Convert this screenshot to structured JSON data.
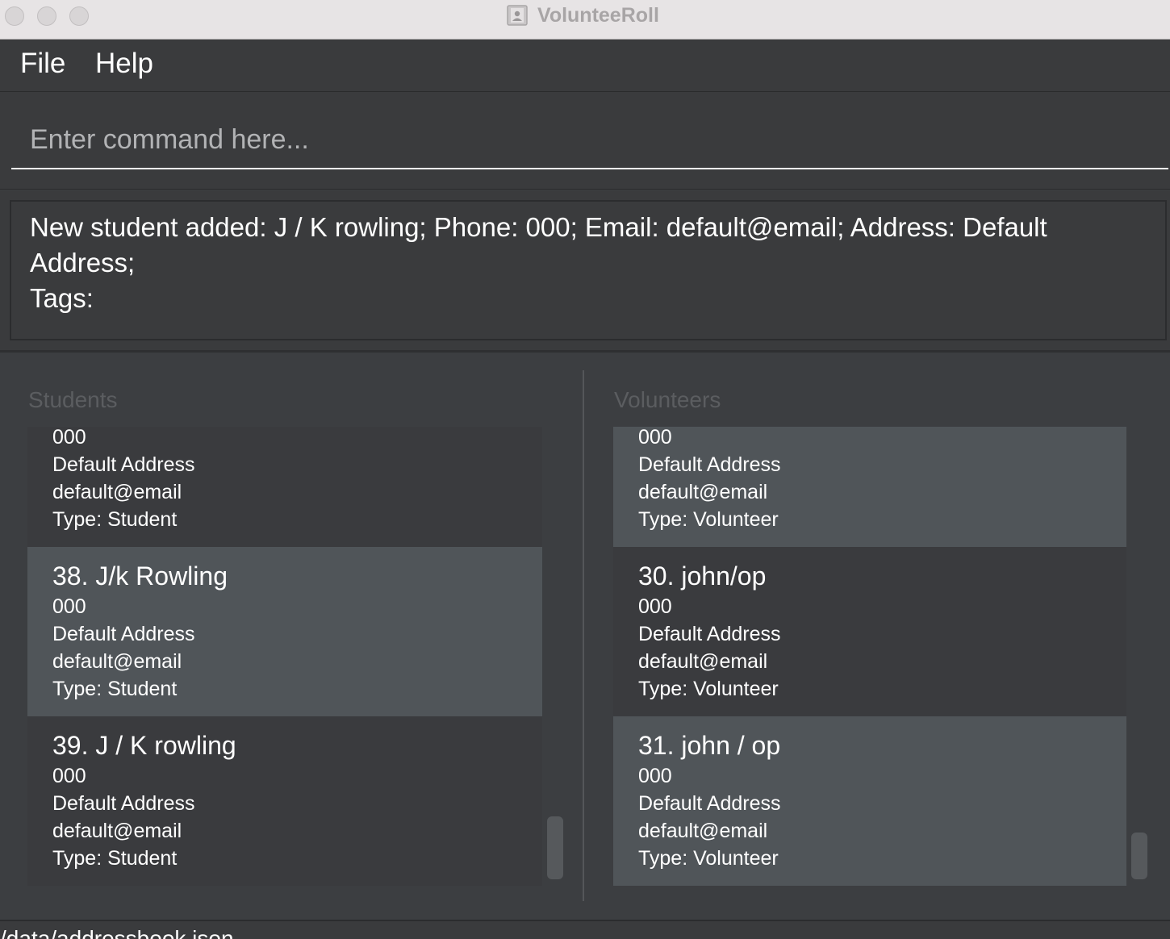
{
  "window": {
    "title": "VolunteeRoll"
  },
  "menu": {
    "file": "File",
    "help": "Help"
  },
  "command": {
    "placeholder": "Enter command here...",
    "value": ""
  },
  "result": {
    "line1": "New student added: J / K rowling; Phone: 000; Email: default@email; Address: Default Address;",
    "line2": "Tags:"
  },
  "students": {
    "title": "Students",
    "cards": [
      {
        "name": "",
        "phone": "000",
        "address": "Default Address",
        "email": "default@email",
        "type": "Type: Student"
      },
      {
        "name": "38. J/k Rowling",
        "phone": "000",
        "address": "Default Address",
        "email": "default@email",
        "type": "Type: Student"
      },
      {
        "name": "39. J / K rowling",
        "phone": "000",
        "address": "Default Address",
        "email": "default@email",
        "type": "Type: Student"
      }
    ]
  },
  "volunteers": {
    "title": "Volunteers",
    "cards": [
      {
        "name": "",
        "phone": "000",
        "address": "Default Address",
        "email": "default@email",
        "type": "Type: Volunteer"
      },
      {
        "name": "30. john/op",
        "phone": "000",
        "address": "Default Address",
        "email": "default@email",
        "type": "Type: Volunteer"
      },
      {
        "name": "31. john / op",
        "phone": "000",
        "address": "Default Address",
        "email": "default@email",
        "type": "Type: Volunteer"
      }
    ]
  },
  "status": {
    "path": "/data/addressbook.json"
  }
}
